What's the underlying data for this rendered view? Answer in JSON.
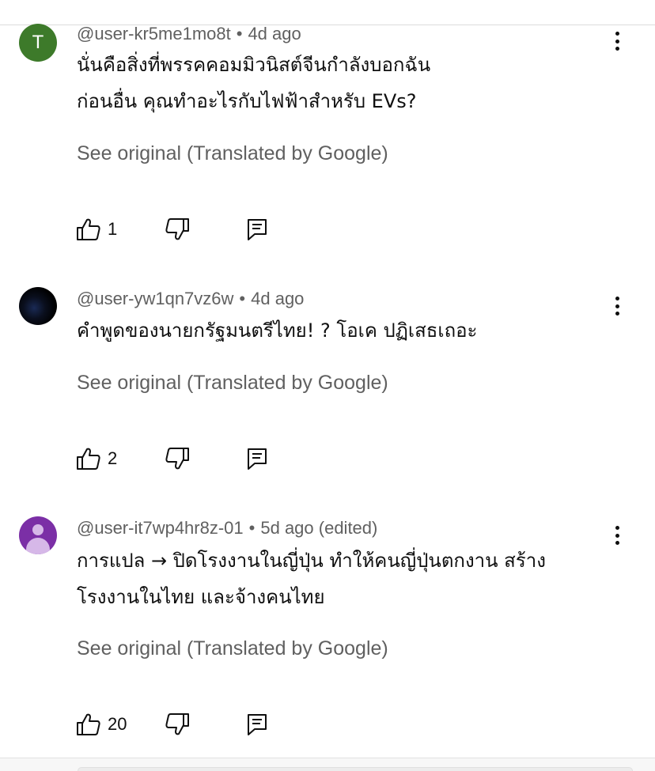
{
  "see_original_label": "See original (Translated by Google)",
  "meta_separator": "•",
  "comments": [
    {
      "avatar_type": "letter",
      "avatar_letter": "T",
      "avatar_color": "#3d7a2a",
      "username": "@user-kr5me1mo8t",
      "time": "4d ago",
      "lines": [
        "นั่นคือสิ่งที่พรรคคอมมิวนิสต์จีนกำลังบอกฉัน",
        "ก่อนอื่น คุณทำอะไรกับไฟฟ้าสำหรับ EVs?"
      ],
      "likes": "1"
    },
    {
      "avatar_type": "image",
      "username": "@user-yw1qn7vz6w",
      "time": "4d ago",
      "lines": [
        "คำพูดของนายกรัฐมนตรีไทย! ? โอเค ปฏิเสธเถอะ"
      ],
      "likes": "2"
    },
    {
      "avatar_type": "default",
      "avatar_color": "#7b2fa6",
      "username": "@user-it7wp4hr8z-01",
      "time": "5d ago (edited)",
      "lines": [
        "การแปล → ปิดโรงงานในญี่ปุ่น ทำให้คนญี่ปุ่นตกงาน สร้าง",
        "โรงงานในไทย และจ้างคนไทย"
      ],
      "likes": "20"
    }
  ],
  "icons": {
    "like": "thumbs-up-icon",
    "dislike": "thumbs-down-icon",
    "reply": "comment-reply-icon",
    "more": "more-vertical-icon"
  }
}
